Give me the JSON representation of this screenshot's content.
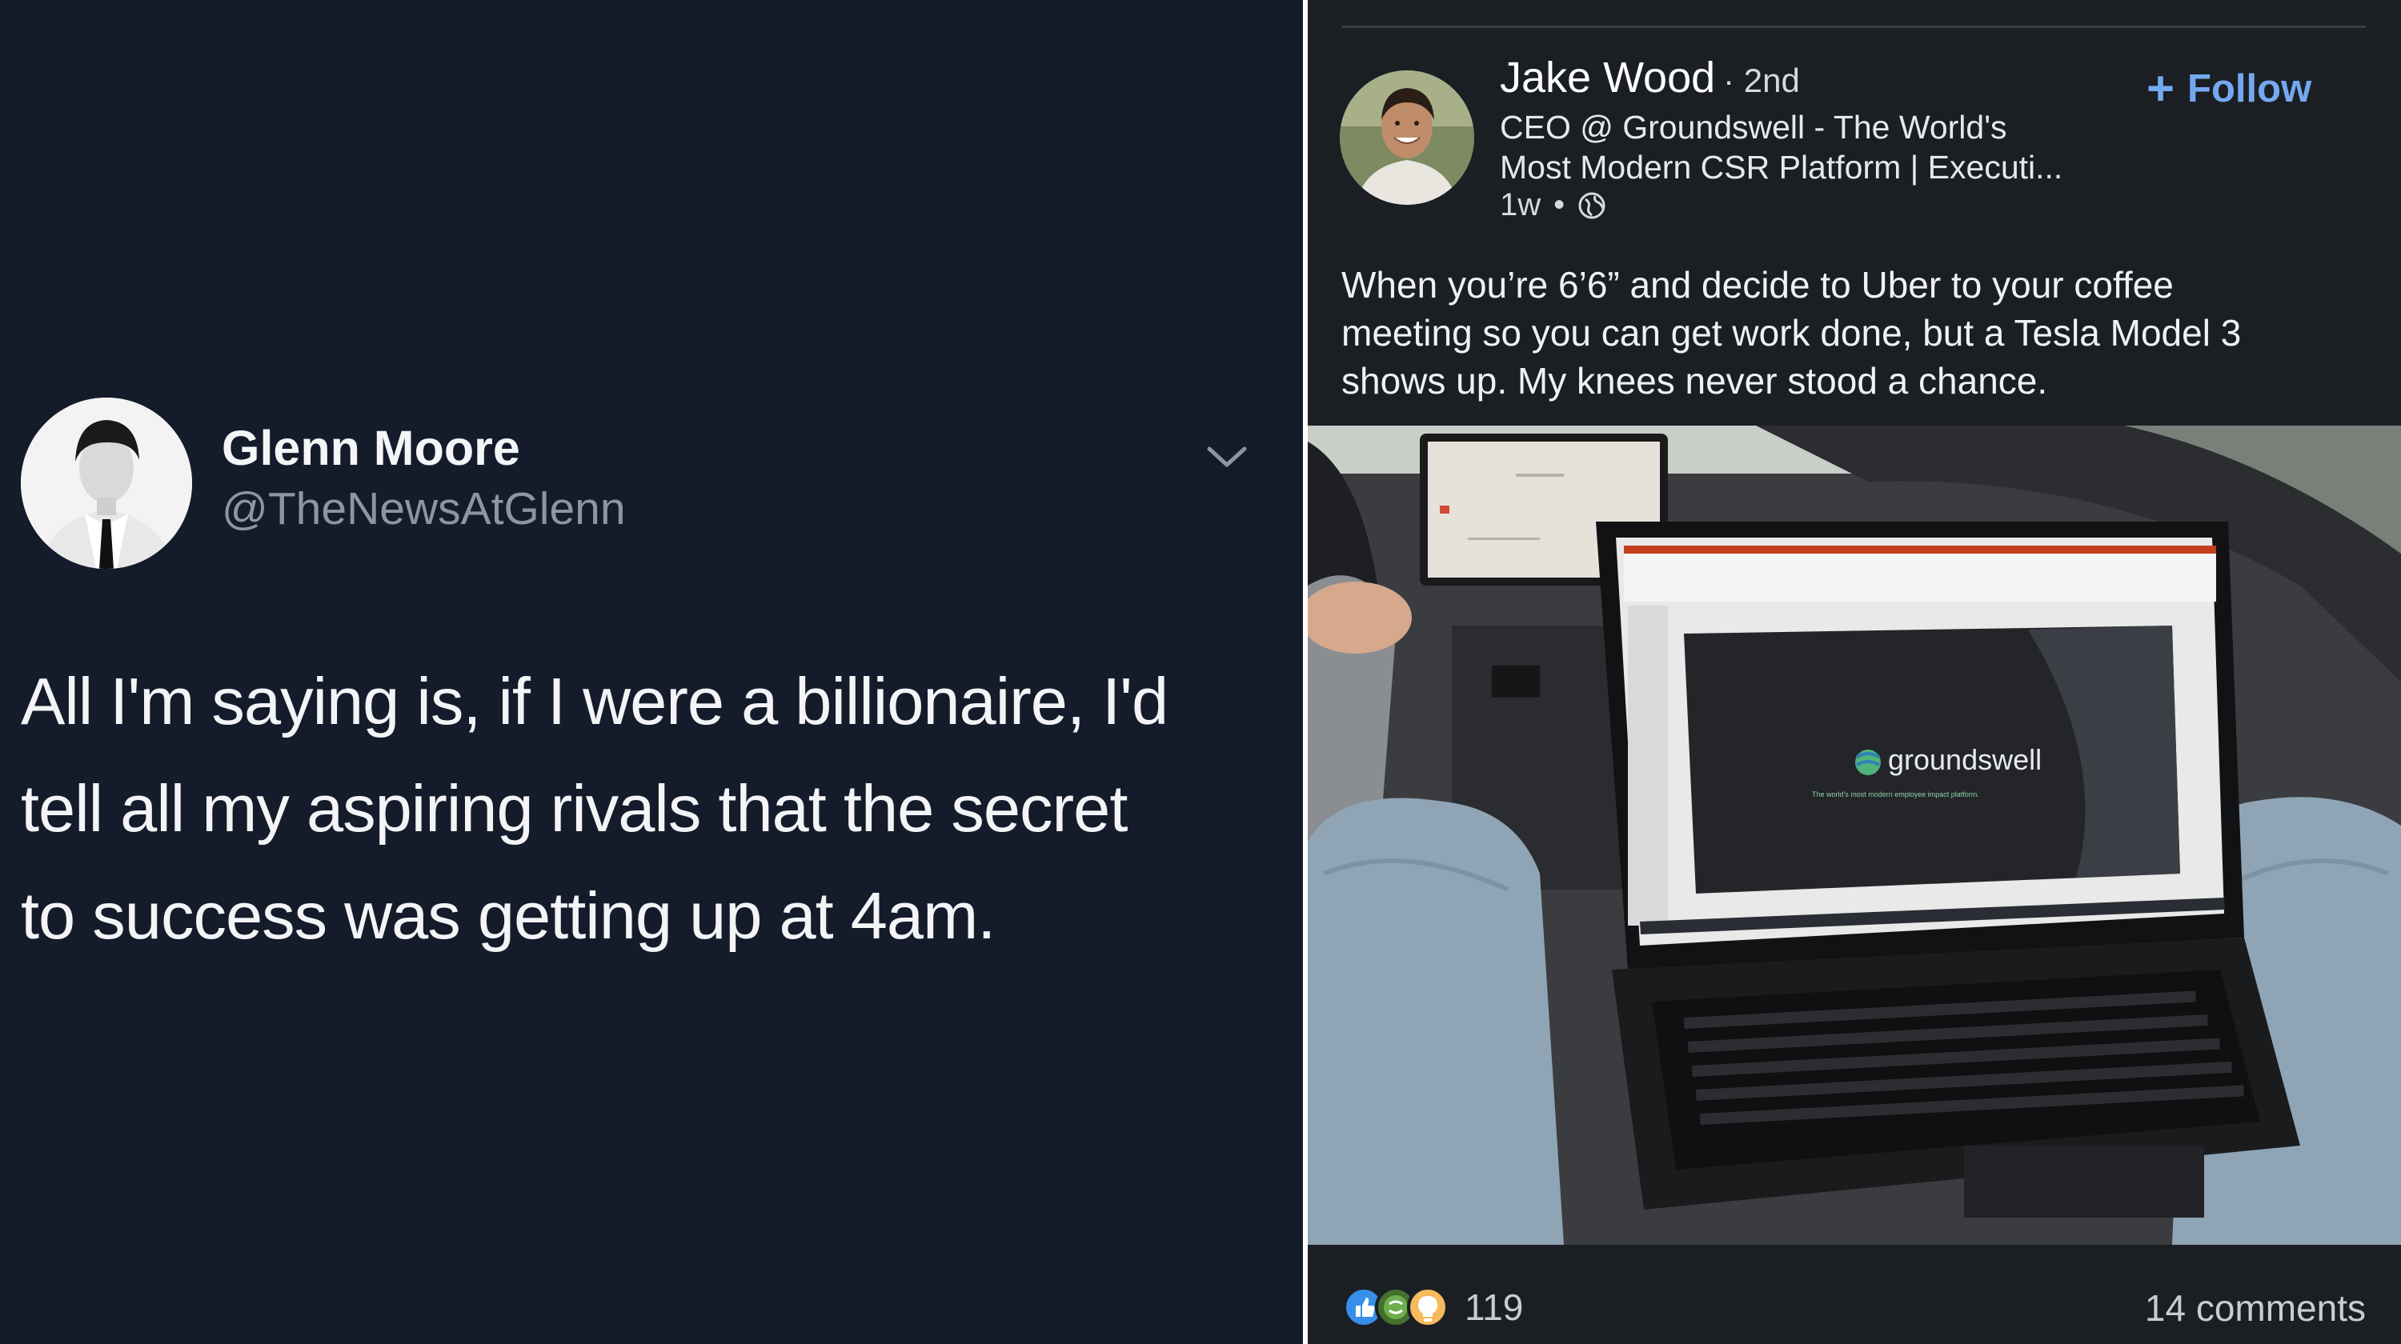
{
  "tweet": {
    "author_name": "Glenn Moore",
    "handle": "@TheNewsAtGlenn",
    "avatar_icon": "person-avatar-icon",
    "menu_icon": "chevron-down-icon",
    "text_lines": [
      "All I'm saying is, if I were a billionaire, I'd",
      "tell all my aspiring rivals that the secret",
      "to success was getting up at 4am."
    ]
  },
  "linkedin": {
    "author_name": "Jake Wood",
    "degree": "· 2nd",
    "headline_lines": [
      "CEO @ Groundswell - The World's",
      "Most Modern CSR Platform | Executi..."
    ],
    "time": "1w",
    "visibility_icon": "globe-icon",
    "follow_label": "Follow",
    "post_text_lines": [
      "When you’re 6’6” and decide to Uber to your coffee",
      "meeting so you can get work done, but a Tesla Model 3",
      "shows up. My knees never stood a chance."
    ],
    "photo": {
      "laptop_screen_brand": "groundswell",
      "laptop_screen_tagline": "The world's most modern employee impact platform."
    },
    "reaction_icons": [
      "like-icon",
      "celebrate-icon",
      "insightful-icon"
    ],
    "reaction_count": "119",
    "comments_label": "14 comments",
    "accent_color": "#74a9f0"
  }
}
